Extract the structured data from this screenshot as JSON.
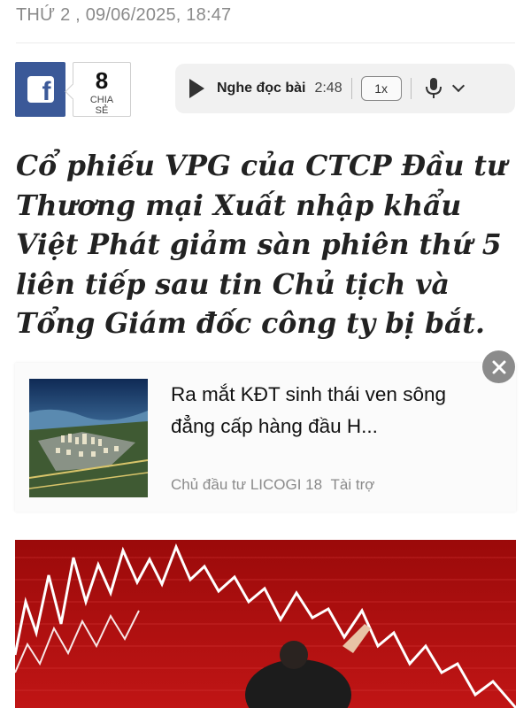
{
  "article": {
    "date": "THỨ 2 , 09/06/2025, 18:47",
    "headline": "Cổ phiếu VPG của CTCP Đầu tư Thương mại Xuất nhập khẩu Việt Phát giảm sàn phiên thứ 5 liên tiếp sau tin Chủ tịch và Tổng Giám đốc công ty bị bắt."
  },
  "share": {
    "icon": "facebook-icon",
    "count": "8",
    "label": "CHIA SẺ"
  },
  "audio": {
    "label": "Nghe đọc bài",
    "duration": "2:48",
    "speed": "1x",
    "icons": [
      "play-icon",
      "microphone-icon",
      "chevron-down-icon"
    ]
  },
  "ad": {
    "title": "Ra mắt KĐT sinh thái ven sông đẳng cấp hàng đầu H...",
    "sponsor": "Chủ đầu tư LICOGI 18",
    "sponsored_label": "Tài trợ",
    "close_icon": "close-icon"
  },
  "colors": {
    "facebook": "#3b5998",
    "photo_red": "#b10f0f"
  }
}
